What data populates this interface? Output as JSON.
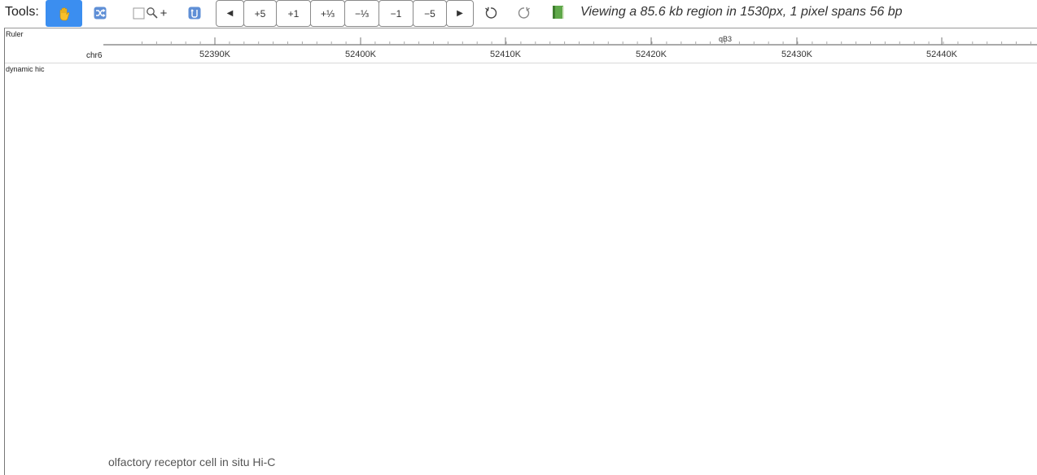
{
  "toolbar": {
    "tools_label": "Tools:",
    "nav": {
      "left": "◀",
      "plus5": "+5",
      "plus1": "+1",
      "plus_third": "+⅓",
      "minus_third": "−⅓",
      "minus1": "−1",
      "minus5": "−5",
      "right": "▶"
    },
    "zoom_plus": "+",
    "status": "Viewing a 85.6 kb region in 1530px, 1 pixel spans 56 bp"
  },
  "colors": {
    "active_tool": "#3b8ef0",
    "book_icon": "#5fa84a"
  },
  "tracks": {
    "ruler": {
      "label": "Ruler",
      "chrom": "chr6",
      "band": "qB3",
      "ticks": [
        "52390K",
        "52400K",
        "52410K",
        "52420K",
        "52430K",
        "52440K"
      ]
    },
    "hic": {
      "label": "dynamic hic",
      "caption": "olfactory receptor cell in situ Hi-C"
    }
  }
}
